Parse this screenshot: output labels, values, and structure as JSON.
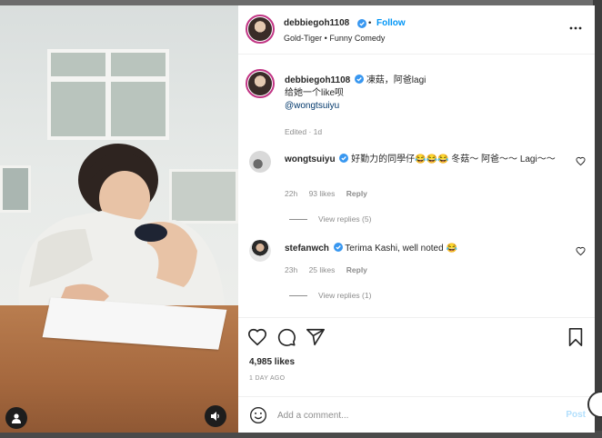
{
  "post": {
    "author": "debbiegoh1108",
    "follow_label": "Follow",
    "separator": "•",
    "subtitle": "Gold-Tiger • Funny Comedy",
    "caption_lines": [
      "凍菇，阿爸lagi",
      "给她一个like呗"
    ],
    "caption_mention": "@wongtsuiyu",
    "edited": "Edited · 1d",
    "likes": "4,985 likes",
    "time": "1 DAY AGO"
  },
  "comments": [
    {
      "username": "wongtsuiyu",
      "text": "好勤力的同學仔😂😂😂 冬菇～ 阿爸～～ Lagi～～",
      "time": "22h",
      "likes": "93 likes",
      "reply": "Reply",
      "view_replies": "View replies (5)"
    },
    {
      "username": "stefanwch",
      "text": "Terima Kashi, well noted 😂",
      "time": "23h",
      "likes": "25 likes",
      "reply": "Reply",
      "view_replies": "View replies (1)"
    }
  ],
  "add_comment": {
    "placeholder": "Add a comment...",
    "post_label": "Post"
  },
  "colors": {
    "accent": "#0095f6",
    "verified": "#3897f0",
    "muted": "#8e8e8e"
  },
  "icons": [
    "more-icon",
    "heart-icon",
    "comment-icon",
    "share-icon",
    "bookmark-icon",
    "emoji-icon",
    "user-tag-icon",
    "sound-icon"
  ]
}
